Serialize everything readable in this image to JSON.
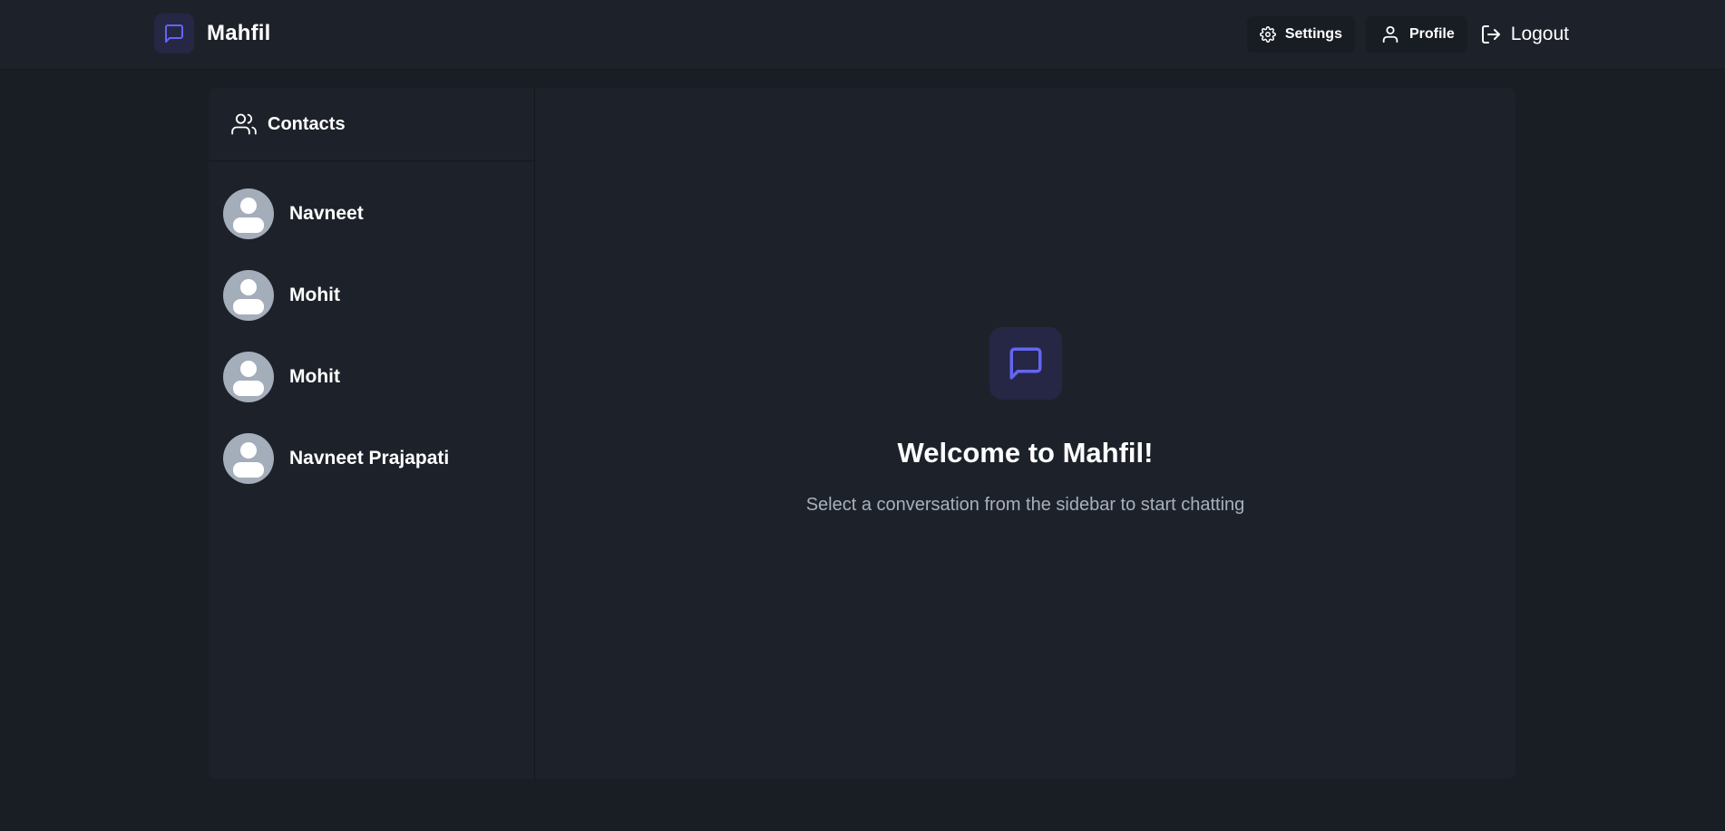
{
  "app": {
    "name": "Mahfil",
    "accent_color": "#6366f1"
  },
  "navbar": {
    "settings_label": "Settings",
    "profile_label": "Profile",
    "logout_label": "Logout"
  },
  "sidebar": {
    "header_label": "Contacts",
    "contacts": [
      {
        "name": "Navneet"
      },
      {
        "name": "Mohit"
      },
      {
        "name": "Mohit"
      },
      {
        "name": "Navneet Prajapati"
      }
    ]
  },
  "main": {
    "welcome_title": "Welcome to Mahfil!",
    "welcome_subtitle": "Select a conversation from the sidebar to start chatting"
  },
  "icons": {
    "logo": "message-square-icon",
    "settings": "gear-icon",
    "profile": "user-icon",
    "logout": "logout-icon",
    "contacts": "users-icon",
    "avatar": "user-avatar-icon",
    "welcome": "message-square-icon"
  }
}
